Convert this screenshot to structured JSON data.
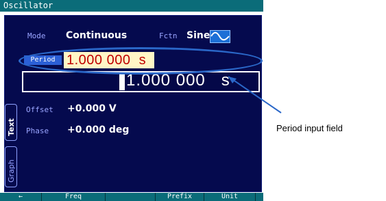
{
  "window": {
    "title": "Oscillator"
  },
  "mode": {
    "label": "Mode",
    "value": "Continuous"
  },
  "fctn": {
    "label": "Fctn",
    "value": "Sine",
    "icon": "sine-wave-icon"
  },
  "period": {
    "tag": "Period",
    "value": "1.000 000",
    "unit": "s"
  },
  "edit": {
    "value": "1.000 000",
    "unit": "s"
  },
  "offset": {
    "label": "Offset",
    "value": "+0.000 V"
  },
  "phase": {
    "label": "Phase",
    "value": "+0.000 deg"
  },
  "tabs": {
    "text": "Text",
    "graph": "Graph"
  },
  "softkeys": [
    "←",
    "Freq",
    "",
    "",
    "Prefix",
    "Unit",
    ""
  ],
  "callout": {
    "text": "Period input field"
  },
  "colors": {
    "background": "#050a4e",
    "titlebar": "#0b6c79",
    "period_value_bg": "#fff6c6",
    "period_value_text": "#c00000",
    "highlight_oval": "#2a67c8"
  }
}
